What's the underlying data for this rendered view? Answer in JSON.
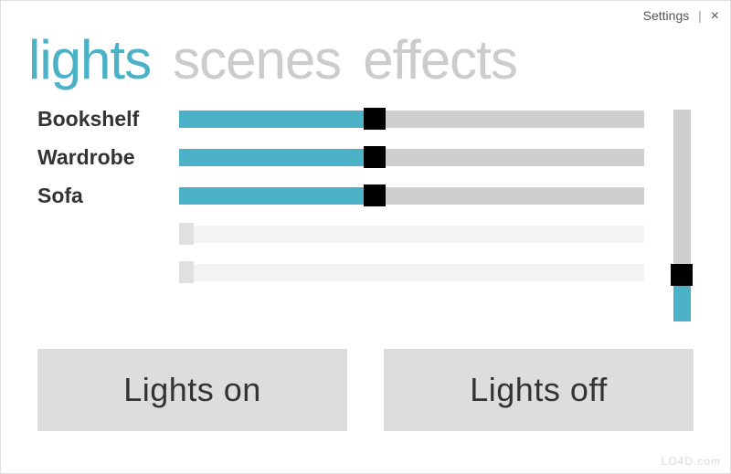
{
  "topbar": {
    "settings_label": "Settings",
    "close_label": "×"
  },
  "tabs": {
    "lights": "lights",
    "scenes": "scenes",
    "effects": "effects"
  },
  "lights": [
    {
      "name": "Bookshelf",
      "value": 42,
      "active": true
    },
    {
      "name": "Wardrobe",
      "value": 42,
      "active": true
    },
    {
      "name": "Sofa",
      "value": 42,
      "active": true
    },
    {
      "name": "",
      "value": 0,
      "active": false
    },
    {
      "name": "",
      "value": 0,
      "active": false
    }
  ],
  "master": {
    "value": 22
  },
  "buttons": {
    "on": "Lights on",
    "off": "Lights off"
  },
  "watermark": "LO4D.com",
  "colors": {
    "accent": "#4ab1c7",
    "inactive_tab": "#cccccc",
    "track": "#cfcfcf",
    "empty_track": "#f3f3f3",
    "button_bg": "#dddddd"
  }
}
